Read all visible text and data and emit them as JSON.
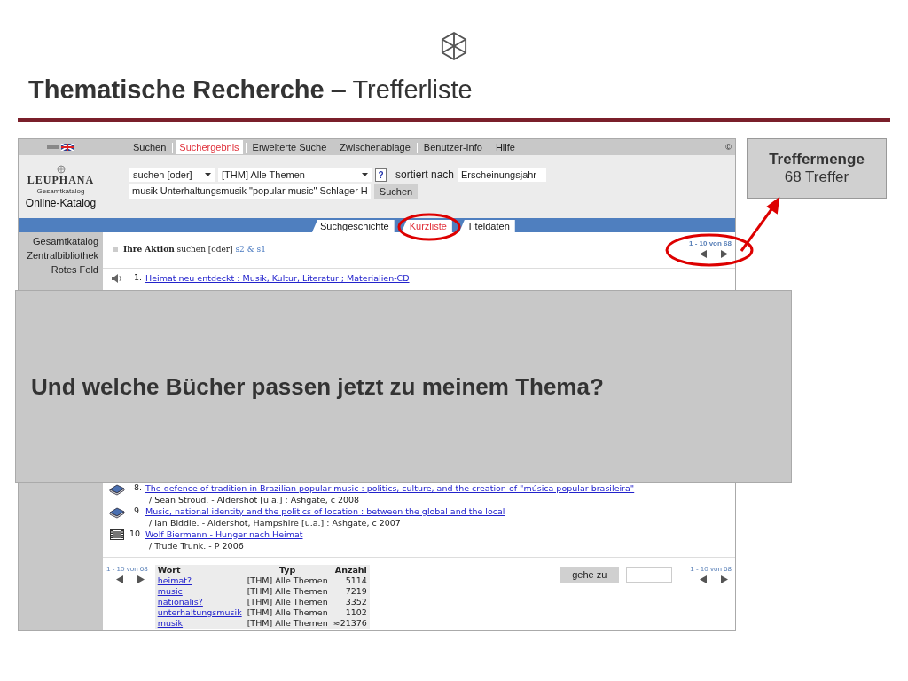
{
  "slide": {
    "title_bold": "Thematische Recherche",
    "title_rest": "– Trefferliste"
  },
  "nav": {
    "tabs": [
      {
        "label": "Suchen",
        "selected": false
      },
      {
        "label": "Suchergebnis",
        "selected": true
      },
      {
        "label": "Erweiterte Suche",
        "selected": false
      },
      {
        "label": "Zwischenablage",
        "selected": false
      },
      {
        "label": "Benutzer-Info",
        "selected": false
      },
      {
        "label": "Hilfe",
        "selected": false
      }
    ],
    "copyright": "©"
  },
  "logo": {
    "name": "LEUPHANA",
    "sub": "Gesamtkatalog",
    "title": "Online-Katalog"
  },
  "search": {
    "mode": "suchen [oder]",
    "category": "[THM] Alle Themen",
    "help": "?",
    "sort_label": "sortiert nach",
    "sort": "Erscheinungsjahr",
    "query": "musik Unterhaltungsmusik \"popular music\" Schlager H",
    "button": "Suchen"
  },
  "view_tabs": [
    {
      "label": "Suchgeschichte",
      "selected": false
    },
    {
      "label": "Kurzliste",
      "selected": true
    },
    {
      "label": "Titeldaten",
      "selected": false
    }
  ],
  "sidebar": [
    "Gesamtkatalog",
    "Zentralbibliothek",
    "Rotes Feld"
  ],
  "action": {
    "label": "Ihre Aktion",
    "text": "suchen [oder]",
    "link": "s2 & s1"
  },
  "pager_top": "1 - 10 von 68",
  "results_top": [
    {
      "number": "1.",
      "kind": "audio",
      "title": "Heimat neu entdeckt : Musik, Kultur, Literatur ; Materialien-CD"
    }
  ],
  "results_bottom": [
    {
      "number": "8.",
      "kind": "book",
      "title": "The defence of tradition in Brazilian popular music : politics, culture, and the creation of \"música popular brasileira\"",
      "details": "/ Sean Stroud. - Aldershot [u.a.] : Ashgate, c 2008"
    },
    {
      "number": "9.",
      "kind": "book",
      "title": "Music, national identity and the politics of location : between the global and the local",
      "details": "/ Ian Biddle. - Aldershot, Hampshire [u.a.] : Ashgate, c 2007"
    },
    {
      "number": "10.",
      "kind": "film",
      "title": "Wolf Biermann - Hunger nach Heimat",
      "details": "/ Trude Trunk. - P 2006"
    }
  ],
  "bottom": {
    "pager_left": "1 - 10 von 68",
    "pager_right": "1 - 10 von 68",
    "goto_button": "gehe zu",
    "columns": [
      "Wort",
      "Typ",
      "Anzahl"
    ],
    "rows": [
      [
        "heimat?",
        "[THM] Alle Themen",
        "5114"
      ],
      [
        "music",
        "[THM] Alle Themen",
        "7219"
      ],
      [
        "nationalis?",
        "[THM] Alle Themen",
        "3352"
      ],
      [
        "unterhaltungsmusik",
        "[THM] Alle Themen",
        "1102"
      ],
      [
        "musik",
        "[THM] Alle Themen",
        "≈21376"
      ]
    ]
  },
  "overlay": {
    "text": "Und welche Bücher passen jetzt zu meinem Thema?"
  },
  "callout": {
    "title": "Treffermenge",
    "text": "68 Treffer"
  }
}
